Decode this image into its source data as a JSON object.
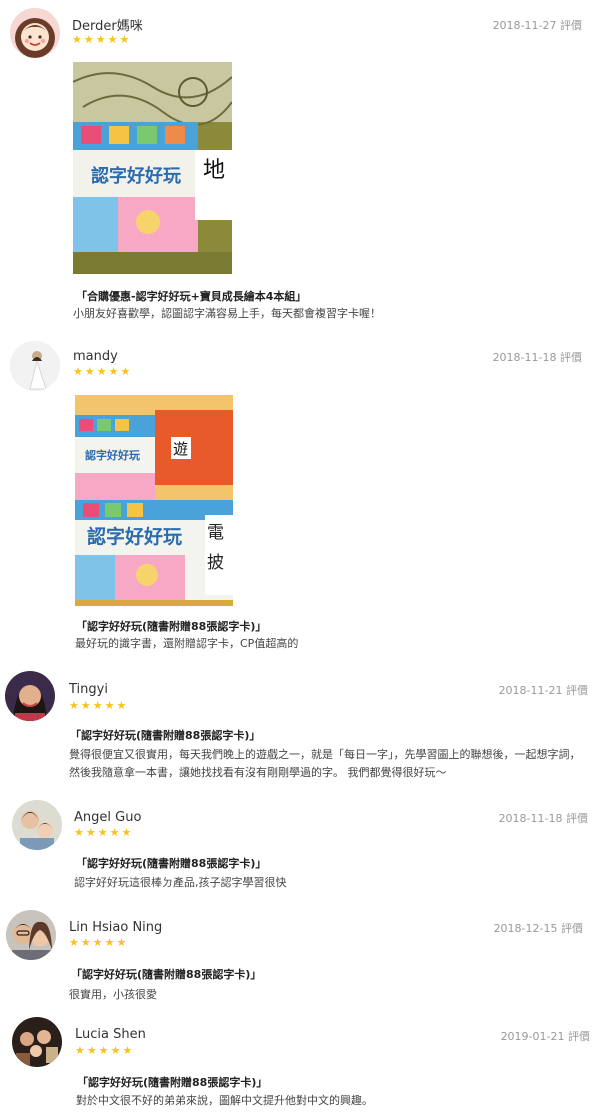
{
  "reviews": [
    {
      "name": "Derder媽咪",
      "date": "2018-11-27 評價",
      "stars": "★★★★★",
      "rating": 5,
      "avatar_icon": "cartoon-girl-avatar",
      "has_photo": true,
      "photo_text": {
        "title": "認字好好玩",
        "card": "地"
      },
      "product": "「合購優惠-認字好好玩+寶貝成長繪本4本組」",
      "text": "小朋友好喜歡學，認圖認字滿容易上手，每天都會複習字卡喔！"
    },
    {
      "name": "mandy",
      "date": "2018-11-18 評價",
      "stars": "★★★★★",
      "rating": 5,
      "avatar_icon": "bride-avatar",
      "has_photo": true,
      "photo_text": {
        "title": "認字好好玩",
        "title_small": "認字好好玩",
        "card1": "遊",
        "card2": "電",
        "card3": "披"
      },
      "product": "「認字好好玩(隨書附贈88張認字卡)」",
      "text": "最好玩的識字書，還附贈認字卡，CP值超高的"
    },
    {
      "name": "Tingyi",
      "date": "2018-11-21 評價",
      "stars": "★★★★★",
      "rating": 5,
      "avatar_icon": "woman-portrait-avatar",
      "product": "「認字好好玩(隨書附贈88張認字卡)」",
      "text": "覺得很便宜又很實用，每天我們晚上的遊戲之一，就是「每日一字」，先學習圖上的聯想後，一起想字詞，然後我隨意拿一本書，讓她找找看有沒有剛剛學過的字。 我們都覺得很好玩～"
    },
    {
      "name": "Angel Guo",
      "date": "2018-11-18 評價",
      "stars": "★★★★★",
      "rating": 5,
      "avatar_icon": "mother-child-avatar",
      "product": "「認字好好玩(隨書附贈88張認字卡)」",
      "text": "認字好好玩這很棒ㄉ產品,孩子認字學習很快"
    },
    {
      "name": "Lin Hsiao Ning",
      "date": "2018-12-15 評價",
      "stars": "★★★★★",
      "rating": 5,
      "avatar_icon": "couple-avatar",
      "product": "「認字好好玩(隨書附贈88張認字卡)」",
      "text": "很實用，小孩很愛"
    },
    {
      "name": "Lucia Shen",
      "date": "2019-01-21 評價",
      "stars": "★★★★★",
      "rating": 5,
      "avatar_icon": "group-photo-avatar",
      "product": "「認字好好玩(隨書附贈88張認字卡)」",
      "text": "對於中文很不好的弟弟來說，圖解中文提升他對中文的興趣。"
    }
  ]
}
